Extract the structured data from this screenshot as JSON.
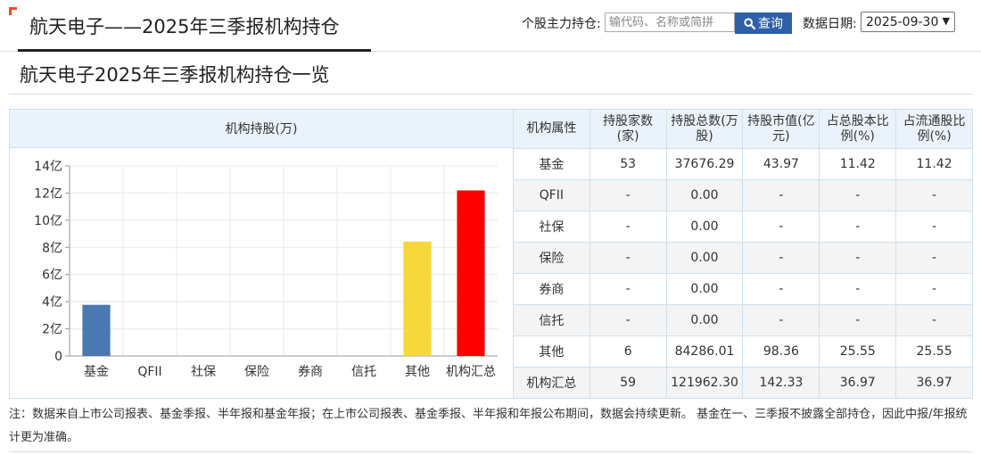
{
  "header": {
    "title": "航天电子——2025年三季报机构持仓",
    "search_label": "个股主力持仓:",
    "search_placeholder": "输代码、名称或简拼",
    "search_button": "查询",
    "date_label": "数据日期:",
    "date_value": "2025-09-30"
  },
  "subtitle": "航天电子2025年三季报机构持仓一览",
  "chart_panel": {
    "heading": "机构持股(万)"
  },
  "chart_data": {
    "type": "bar",
    "categories": [
      "基金",
      "QFII",
      "社保",
      "保险",
      "券商",
      "信托",
      "其他",
      "机构汇总"
    ],
    "values": [
      3.7676,
      0,
      0,
      0,
      0,
      0,
      8.4286,
      12.1962
    ],
    "colors": [
      "#4a78b0",
      "#4a78b0",
      "#4a78b0",
      "#4a78b0",
      "#4a78b0",
      "#4a78b0",
      "#f8d73a",
      "#ff0000"
    ],
    "y_tick_labels": [
      "0",
      "2亿",
      "4亿",
      "6亿",
      "8亿",
      "10亿",
      "12亿",
      "14亿"
    ],
    "ylim": [
      0,
      14
    ],
    "grid": true
  },
  "table": {
    "headers": [
      "机构属性",
      "持股家数(家)",
      "持股总数(万股)",
      "持股市值(亿元)",
      "占总股本比例(%)",
      "占流通股比例(%)"
    ],
    "rows": [
      [
        "基金",
        "53",
        "37676.29",
        "43.97",
        "11.42",
        "11.42"
      ],
      [
        "QFII",
        "-",
        "0.00",
        "-",
        "-",
        "-"
      ],
      [
        "社保",
        "-",
        "0.00",
        "-",
        "-",
        "-"
      ],
      [
        "保险",
        "-",
        "0.00",
        "-",
        "-",
        "-"
      ],
      [
        "券商",
        "-",
        "0.00",
        "-",
        "-",
        "-"
      ],
      [
        "信托",
        "-",
        "0.00",
        "-",
        "-",
        "-"
      ],
      [
        "其他",
        "6",
        "84286.01",
        "98.36",
        "25.55",
        "25.55"
      ],
      [
        "机构汇总",
        "59",
        "121962.30",
        "142.33",
        "36.97",
        "36.97"
      ]
    ]
  },
  "note": "注：数据来自上市公司报表、基金季报、半年报和基金年报；在上市公司报表、基金季报、半年报和年报公布期间，数据会持续更新。 基金在一、三季报不披露全部持仓，因此中报/年报统计更为准确。",
  "icons": {
    "corner": "corner-bracket-icon",
    "search": "search-icon",
    "dropdown": "chevron-down-icon"
  }
}
